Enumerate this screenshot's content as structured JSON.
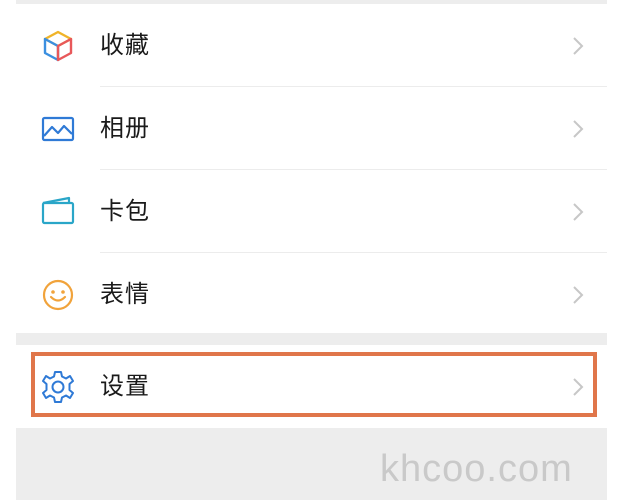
{
  "menu": {
    "items": [
      {
        "label": "收藏",
        "icon": "favorites-cube-icon"
      },
      {
        "label": "相册",
        "icon": "album-picture-icon"
      },
      {
        "label": "卡包",
        "icon": "card-wallet-icon"
      },
      {
        "label": "表情",
        "icon": "sticker-smiley-icon"
      }
    ],
    "settings": {
      "label": "设置",
      "icon": "gear-icon"
    }
  },
  "watermark": "khcoo.com",
  "colors": {
    "background": "#ededed",
    "row": "#ffffff",
    "highlight_border": "#e0764a",
    "icon_blue": "#2f7ad6",
    "icon_smiley": "#f1a33b",
    "chevron": "#c7c7c7"
  }
}
